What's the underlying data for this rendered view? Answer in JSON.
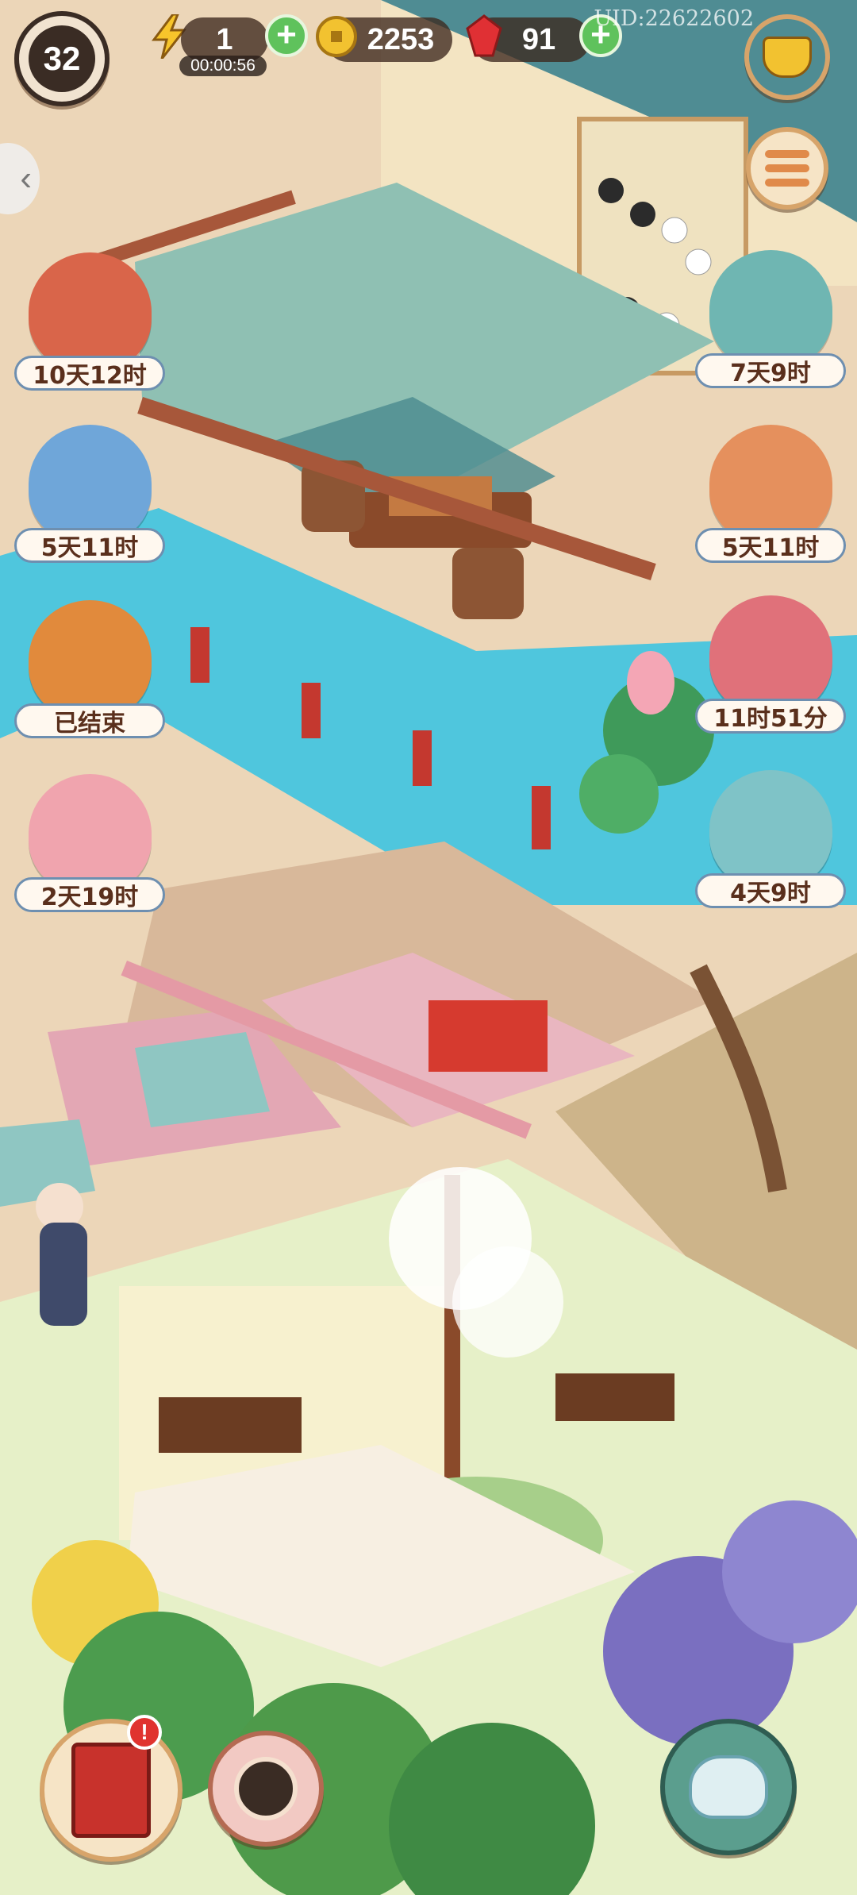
{
  "hud": {
    "level": "32",
    "energy": "1",
    "energy_timer": "00:00:56",
    "coins": "2253",
    "gems": "91",
    "uid": "UID:22622602"
  },
  "events_left": [
    {
      "name": "maple-book-event",
      "time": "10天12时",
      "color": "#d9654a"
    },
    {
      "name": "snowman-cats-event",
      "time": "5天11时",
      "color": "#6fa6d9"
    },
    {
      "name": "phoenix-event",
      "time": "已结束",
      "color": "#e18a3c"
    },
    {
      "name": "chinchilla-event",
      "time": "2天19时",
      "color": "#f0a4ae"
    }
  ],
  "events_right": [
    {
      "name": "tiger-cat-event",
      "time": "7天9时",
      "color": "#6fb6b2"
    },
    {
      "name": "orange-cat-event",
      "time": "5天11时",
      "color": "#e5905d"
    },
    {
      "name": "red-cat-event",
      "time": "11时51分",
      "color": "#e0717a"
    },
    {
      "name": "ice-cat-event",
      "time": "4天9时",
      "color": "#7fc3c7"
    }
  ],
  "colors": {
    "accent_green": "#5fc25c",
    "hud_bg": "#3c281e",
    "label_text": "#5a2f1c"
  }
}
